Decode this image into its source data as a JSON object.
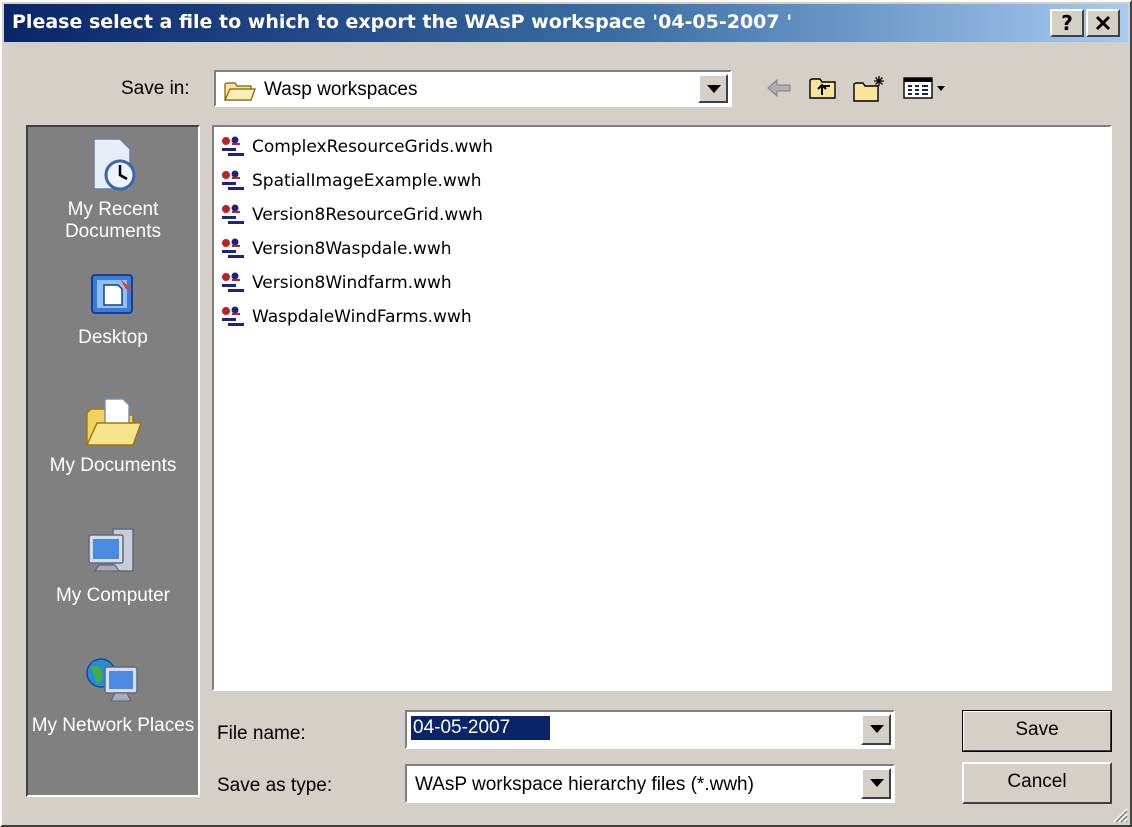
{
  "window": {
    "title": "Please select a file to which to export the WAsP workspace '04-05-2007 '",
    "help_glyph": "?",
    "close_glyph": "✕"
  },
  "save_in": {
    "label": "Save in:",
    "value": "Wasp workspaces",
    "icon": "folder-icon"
  },
  "toolbar": {
    "icons": [
      "back-arrow-icon",
      "up-folder-icon",
      "new-folder-icon",
      "view-menu-icon"
    ]
  },
  "places": [
    {
      "label": "My Recent Documents",
      "icon": "recent-documents-icon"
    },
    {
      "label": "Desktop",
      "icon": "desktop-icon"
    },
    {
      "label": "My Documents",
      "icon": "my-documents-icon"
    },
    {
      "label": "My Computer",
      "icon": "my-computer-icon"
    },
    {
      "label": "My Network Places",
      "icon": "network-places-icon"
    }
  ],
  "files": [
    {
      "name": "ComplexResourceGrids.wwh"
    },
    {
      "name": "SpatialImageExample.wwh"
    },
    {
      "name": "Version8ResourceGrid.wwh"
    },
    {
      "name": "Version8Waspdale.wwh"
    },
    {
      "name": "Version8Windfarm.wwh"
    },
    {
      "name": "WaspdaleWindFarms.wwh"
    }
  ],
  "file_name": {
    "label": "File name:",
    "value": "04-05-2007"
  },
  "save_as_type": {
    "label": "Save as type:",
    "value": "WAsP workspace hierarchy files (*.wwh)"
  },
  "buttons": {
    "save": "Save",
    "cancel": "Cancel"
  },
  "colors": {
    "title_gradient_start": "#0a246a",
    "dialog_face": "#d4d0c8",
    "places_bar": "#808080",
    "selection": "#0a246a"
  }
}
